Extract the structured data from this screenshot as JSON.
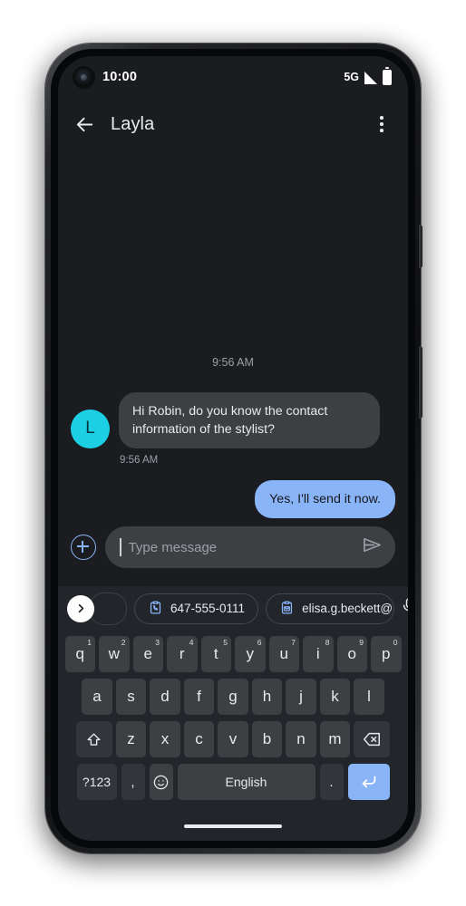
{
  "status_bar": {
    "time": "10:00",
    "network": "5G",
    "signal_icon": "signal-bars-icon",
    "battery_icon": "battery-full-icon",
    "camera_icon": "front-camera-punch-hole"
  },
  "app_bar": {
    "back_icon": "back-arrow-icon",
    "title": "Layla",
    "overflow_icon": "more-vert-icon"
  },
  "conversation": {
    "day_stamp": "9:56 AM",
    "incoming": {
      "avatar_initial": "L",
      "avatar_color": "#1CCFE4",
      "text": "Hi Robin, do you know the contact information of the stylist?",
      "timestamp": "9:56 AM",
      "bubble_color": "#3C4043"
    },
    "outgoing": {
      "text": "Yes, I'll send it now.",
      "bubble_color": "#8AB4F8"
    }
  },
  "composer": {
    "attach_icon": "plus-circle-icon",
    "placeholder": "Type message",
    "value": "",
    "send_icon": "send-icon"
  },
  "chip_strip": {
    "expand_icon": "chevron-right-icon",
    "chips": [
      {
        "icon": "clipboard-phone-icon",
        "label": "647-555-0111"
      },
      {
        "icon": "clipboard-email-icon",
        "label": "elisa.g.beckett@"
      }
    ],
    "mic_icon": "microphone-icon",
    "accent": "#8AB4F8"
  },
  "keyboard": {
    "row1": [
      {
        "key": "q",
        "num": "1"
      },
      {
        "key": "w",
        "num": "2"
      },
      {
        "key": "e",
        "num": "3"
      },
      {
        "key": "r",
        "num": "4"
      },
      {
        "key": "t",
        "num": "5"
      },
      {
        "key": "y",
        "num": "6"
      },
      {
        "key": "u",
        "num": "7"
      },
      {
        "key": "i",
        "num": "8"
      },
      {
        "key": "o",
        "num": "9"
      },
      {
        "key": "p",
        "num": "0"
      }
    ],
    "row2": [
      "a",
      "s",
      "d",
      "f",
      "g",
      "h",
      "j",
      "k",
      "l"
    ],
    "row3": [
      "z",
      "x",
      "c",
      "v",
      "b",
      "n",
      "m"
    ],
    "shift_icon": "shift-up-icon",
    "backspace_icon": "backspace-icon",
    "symbols_label": "?123",
    "comma_label": ",",
    "emoji_icon": "emoji-smiley-icon",
    "space_label": "English",
    "period_label": ".",
    "enter_icon": "enter-return-icon",
    "enter_color": "#8AB4F8"
  },
  "system": {
    "home_indicator": "home-gesture-bar"
  }
}
